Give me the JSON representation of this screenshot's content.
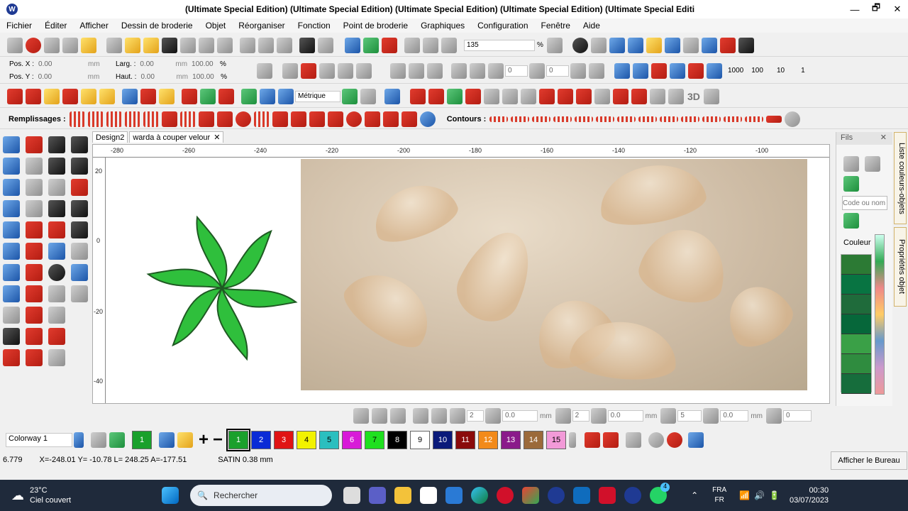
{
  "window": {
    "title": "(Ultimate Special Edition) (Ultimate Special Edition) (Ultimate Special Edition) (Ultimate Special Edition) (Ultimate Special Editi",
    "minimize": "—",
    "maximize": "🗗",
    "close": "✕"
  },
  "menu": [
    "Fichier",
    "Éditer",
    "Afficher",
    "Dessin de broderie",
    "Objet",
    "Réorganiser",
    "Fonction",
    "Point de broderie",
    "Graphiques",
    "Configuration",
    "Fenêtre",
    "Aide"
  ],
  "toolbar1": {
    "zoom_value": "135",
    "zoom_unit": "%"
  },
  "position": {
    "pos_x_label": "Pos. X :",
    "pos_x": "0.00",
    "pos_x_unit": "mm",
    "pos_y_label": "Pos. Y :",
    "pos_y": "0.00",
    "pos_y_unit": "mm",
    "width_label": "Larg. :",
    "width": "0.00",
    "width_unit": "mm",
    "width_pct": "100.00",
    "width_pct_unit": "%",
    "height_label": "Haut. :",
    "height": "0.00",
    "height_unit": "mm",
    "height_pct": "100.00",
    "height_pct_unit": "%",
    "angle1": "0",
    "angle2": "0",
    "counts": [
      "1000",
      "100",
      "10",
      "1"
    ]
  },
  "toolbar3": {
    "units": "Métrique",
    "label_3d": "3D"
  },
  "fills": {
    "label": "Remplissages :",
    "contours_label": "Contours :"
  },
  "tabs": [
    {
      "label": "Design2",
      "close": "✕"
    },
    {
      "label": "warda à couper velour",
      "close": "✕"
    }
  ],
  "ruler": {
    "h_ticks": [
      "-280",
      "-260",
      "-240",
      "-220",
      "-200",
      "-180",
      "-160",
      "-140",
      "-120",
      "-100"
    ],
    "v_ticks": [
      "20",
      "0",
      "-20",
      "-40"
    ]
  },
  "side_panel": {
    "title": "Fils",
    "pin": "📌",
    "close": "✕",
    "search_placeholder": "Code ou nom",
    "column_label": "Couleur",
    "swatch_colors": [
      "#2c7a34",
      "#087442",
      "#1f6b3b",
      "#06673a",
      "#3aa047",
      "#2f8c3f",
      "#166d3c"
    ]
  },
  "vertical_tabs": [
    "Liste couleurs-objets",
    "Propriétés objet"
  ],
  "bottom_toolbar": {
    "f1": "2",
    "f2": "0.0",
    "f2_unit": "mm",
    "f3": "2",
    "f4": "0.0",
    "f4_unit": "mm",
    "f5": "5",
    "f6": "0.0",
    "f6_unit": "mm",
    "f7": "0"
  },
  "colorway": {
    "label": "Colorway 1",
    "current": "1",
    "colors": [
      {
        "n": "1",
        "c": "#1aa02c"
      },
      {
        "n": "2",
        "c": "#0a2bd6"
      },
      {
        "n": "3",
        "c": "#e01414"
      },
      {
        "n": "4",
        "c": "#f2f200"
      },
      {
        "n": "5",
        "c": "#2bbfbf"
      },
      {
        "n": "6",
        "c": "#d81ad8"
      },
      {
        "n": "7",
        "c": "#1fe01f"
      },
      {
        "n": "8",
        "c": "#000000"
      },
      {
        "n": "9",
        "c": "#ffffff"
      },
      {
        "n": "10",
        "c": "#0a1a7a"
      },
      {
        "n": "11",
        "c": "#8a0b0b"
      },
      {
        "n": "12",
        "c": "#f28a1a"
      },
      {
        "n": "13",
        "c": "#8a1a8a"
      },
      {
        "n": "14",
        "c": "#9b6a3a"
      },
      {
        "n": "15",
        "c": "#f29ad8"
      }
    ]
  },
  "status": {
    "value": "6.779",
    "coords": "X=-248.01 Y= -10.78 L= 248.25 A=-177.51",
    "stitch": "SATIN  0.38 mm",
    "tooltip": "Afficher le Bureau"
  },
  "taskbar": {
    "temp": "23°C",
    "weather": "Ciel couvert",
    "search": "Rechercher",
    "lang1": "FRA",
    "lang2": "FR",
    "time": "00:30",
    "date": "03/07/2023",
    "badge": "4"
  }
}
